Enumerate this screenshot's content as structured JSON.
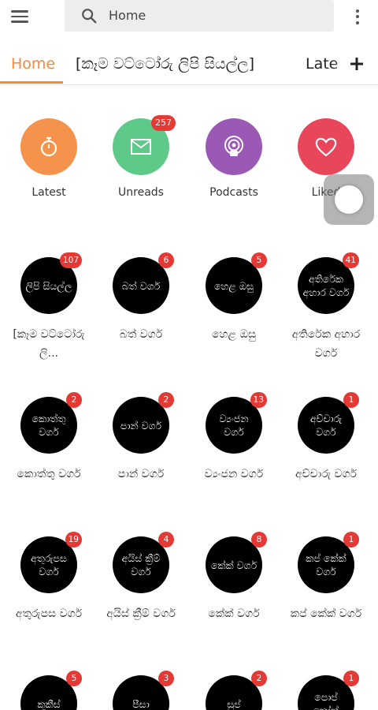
{
  "search": {
    "placeholder": "Home"
  },
  "tabs": [
    {
      "label": "Home"
    },
    {
      "label": "[කෑම වට්ටෝරු ලිපි සියල්ල]"
    },
    {
      "label": "Late"
    }
  ],
  "quick_links": [
    {
      "label": "Latest",
      "color": "#f5924b",
      "icon": "stopwatch-icon",
      "badge": ""
    },
    {
      "label": "Unreads",
      "color": "#5fc98a",
      "icon": "mail-icon",
      "badge": "257"
    },
    {
      "label": "Podcasts",
      "color": "#9b59b6",
      "icon": "podcast-icon",
      "badge": ""
    },
    {
      "label": "Liked",
      "color": "#e8465a",
      "icon": "heart-icon",
      "badge": ""
    }
  ],
  "feeds": [
    {
      "circle": "ලිපි සියල්ල",
      "badge": "107",
      "label": "[කෑම වට්ටෝරු ලි..."
    },
    {
      "circle": "බත් වර්ග",
      "badge": "6",
      "label": "බත් වර්ග"
    },
    {
      "circle": "හෙළ ඔසු",
      "badge": "5",
      "label": "හෙළ ඔසු"
    },
    {
      "circle": "අතිරේක අහාර වර්ග",
      "badge": "41",
      "label": "අතිරේක අහාර වර්ග"
    },
    {
      "circle": "කොත්තු වර්ග",
      "badge": "2",
      "label": "කොත්තු වර්ග"
    },
    {
      "circle": "පාන් වර්ග",
      "badge": "2",
      "label": "පාන් වර්ග"
    },
    {
      "circle": "ව්‍යංජන වර්ග",
      "badge": "13",
      "label": "ව්‍යංජන වර්ග"
    },
    {
      "circle": "අච්චාරු වර්ග",
      "badge": "1",
      "label": "අච්චාරු වර්ග"
    },
    {
      "circle": "අතුරුපස වර්ග",
      "badge": "19",
      "label": "අතුරුපස වර්ග"
    },
    {
      "circle": "අයිස් ක්‍රීම් වර්ග",
      "badge": "4",
      "label": "අයිස් ක්‍රීම් වර්ග"
    },
    {
      "circle": "කේක් වර්ග",
      "badge": "8",
      "label": "කේක් වර්ග"
    },
    {
      "circle": "කප් කේක් වර්ග",
      "badge": "1",
      "label": "කප් කේක් වර්ග"
    },
    {
      "circle": "කුකීස්",
      "badge": "5",
      "label": ""
    },
    {
      "circle": "පීසා",
      "badge": "3",
      "label": ""
    },
    {
      "circle": "සුප්",
      "badge": "2",
      "label": ""
    },
    {
      "circle": "පොප් කෝන්",
      "badge": "1",
      "label": ""
    }
  ]
}
